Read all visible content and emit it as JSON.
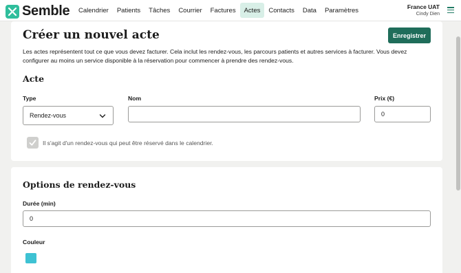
{
  "brand": {
    "name": "Semble",
    "color": "#2fbe9c"
  },
  "nav": {
    "items": [
      {
        "label": "Calendrier"
      },
      {
        "label": "Patients"
      },
      {
        "label": "Tâches"
      },
      {
        "label": "Courrier"
      },
      {
        "label": "Factures"
      },
      {
        "label": "Actes",
        "active": true
      },
      {
        "label": "Contacts"
      },
      {
        "label": "Data"
      },
      {
        "label": "Paramètres"
      }
    ]
  },
  "user": {
    "org": "France UAT",
    "name": "Cindy Dien"
  },
  "page": {
    "title": "Créer un nouvel acte",
    "save_label": "Enregistrer",
    "intro": "Les actes représentent tout ce que vous devez facturer. Cela inclut les rendez-vous, les parcours patients et autres services à facturer. Vous devez configurer au moins un service disponible à la réservation pour commencer à prendre des rendez-vous."
  },
  "acte": {
    "section_title": "Acte",
    "type_label": "Type",
    "type_value": "Rendez-vous",
    "name_label": "Nom",
    "name_value": "",
    "price_label": "Prix (€)",
    "price_value": "0",
    "bookable_label": "Il s'agit d'un rendez-vous qui peut être réservé dans le calendrier.",
    "bookable_checked": true
  },
  "options": {
    "section_title": "Options de rendez-vous",
    "duration_label": "Durée (min)",
    "duration_value": "0",
    "color_label": "Couleur",
    "color_value": "#3ec2d3"
  }
}
